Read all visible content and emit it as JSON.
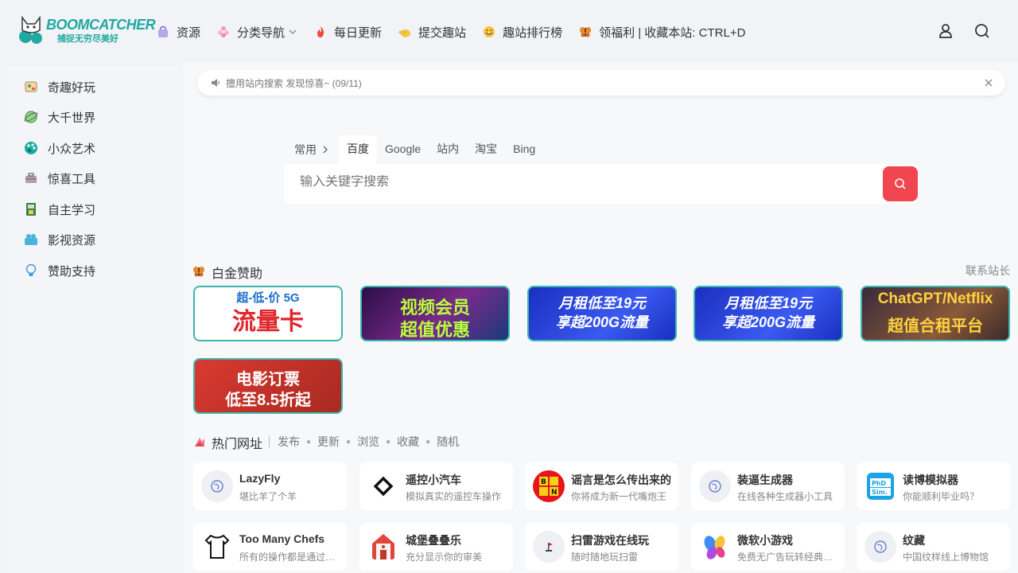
{
  "logo": {
    "title": "BOOMCATCHER",
    "subtitle": "捕捉无穷尽美好"
  },
  "nav": [
    {
      "label": "资源",
      "icon": "bag-icon"
    },
    {
      "label": "分类导航",
      "icon": "flower-icon"
    },
    {
      "label": "每日更新",
      "icon": "fire-icon"
    },
    {
      "label": "提交趣站",
      "icon": "pointing-hand-icon"
    },
    {
      "label": "趣站排行榜",
      "icon": "smile-face-icon"
    },
    {
      "label": "领福利 | 收藏本站: CTRL+D",
      "icon": "butterfly-icon"
    }
  ],
  "sidebar": [
    {
      "label": "奇趣好玩",
      "icon": "game-icon"
    },
    {
      "label": "大千世界",
      "icon": "globe-icon"
    },
    {
      "label": "小众艺术",
      "icon": "palette-icon"
    },
    {
      "label": "惊喜工具",
      "icon": "toolbox-icon"
    },
    {
      "label": "自主学习",
      "icon": "book-icon"
    },
    {
      "label": "影视资源",
      "icon": "video-icon"
    },
    {
      "label": "赞助支持",
      "icon": "lightbulb-icon"
    }
  ],
  "notice": {
    "text": "擅用站内搜索 发现惊喜~ (09/11)"
  },
  "search": {
    "category": "常用",
    "tabs": [
      "百度",
      "Google",
      "站内",
      "淘宝",
      "Bing"
    ],
    "active_tab": "百度",
    "placeholder": "输入关键字搜索"
  },
  "sponsor": {
    "title": "白金赞助",
    "contact": "联系站长",
    "ads": [
      {
        "line1": "超-低-价 5G",
        "line2": "流量卡",
        "colors": {
          "bg": "#ffffff",
          "fg": "#e0252b"
        }
      },
      {
        "line1": "视频会员",
        "line2": "超值优惠",
        "colors": {
          "bg": "#3a1a55",
          "fg": "#b8ff3c"
        }
      },
      {
        "line1": "月租低至19元",
        "line2": "享超200G流量",
        "colors": {
          "bg": "#2440d8",
          "fg": "#ffffff"
        }
      },
      {
        "line1": "月租低至19元",
        "line2": "享超200G流量",
        "colors": {
          "bg": "#2440d8",
          "fg": "#ffffff"
        }
      },
      {
        "line1": "ChatGPT/Netflix",
        "line2": "超值合租平台",
        "colors": {
          "bg": "#5a3a2a",
          "fg": "#ffd23f"
        }
      },
      {
        "line1": "电影订票",
        "line2": "低至8.5折起",
        "colors": {
          "bg": "#c9302c",
          "fg": "#ffffff"
        }
      }
    ]
  },
  "hot": {
    "title": "热门网址",
    "filters": [
      "发布",
      "更新",
      "浏览",
      "收藏",
      "随机"
    ],
    "cards": [
      {
        "title": "LazyFly",
        "desc": "堪比羊了个羊",
        "icon": "globe-placeholder-icon"
      },
      {
        "title": "遥控小汽车",
        "desc": "模拟真实的遥控车操作",
        "icon": "diamond-icon"
      },
      {
        "title": "谣言是怎么传出来的",
        "desc": "你将成为新一代嘴炮王",
        "icon": "bn-logo-icon"
      },
      {
        "title": "装逼生成器",
        "desc": "在线各种生成器小工具",
        "icon": "globe-placeholder-icon"
      },
      {
        "title": "读博模拟器",
        "desc": "你能顺利毕业吗？",
        "icon": "phd-sim-icon"
      },
      {
        "title": "Too Many Chefs",
        "desc": "所有的操作都是通过键盘完成",
        "icon": "chef-shirt-icon"
      },
      {
        "title": "城堡叠叠乐",
        "desc": "充分显示你的审美",
        "icon": "house-icon"
      },
      {
        "title": "扫雷游戏在线玩",
        "desc": "随时随地玩扫雷",
        "icon": "flag-icon"
      },
      {
        "title": "微软小游戏",
        "desc": "免费无广告玩转经典游戏",
        "icon": "microsoft-games-icon"
      },
      {
        "title": "纹藏",
        "desc": "中国纹样线上博物馆",
        "icon": "globe-placeholder-icon"
      }
    ]
  },
  "colors": {
    "accent": "#f14650",
    "brand": "#1fa9a0"
  }
}
